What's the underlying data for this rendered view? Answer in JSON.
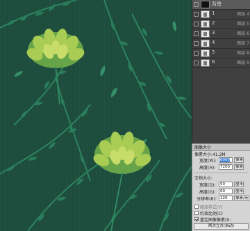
{
  "layers_panel": {
    "layers": [
      {
        "name": "背景",
        "suffix": "",
        "thumb": "dark",
        "selected": true
      },
      {
        "name": "1",
        "suffix": "图层 4",
        "thumb": "light",
        "selected": false
      },
      {
        "name": "2",
        "suffix": "图层 5",
        "thumb": "light",
        "selected": false
      },
      {
        "name": "3",
        "suffix": "图层 6",
        "thumb": "light",
        "selected": false
      },
      {
        "name": "4",
        "suffix": "图层 7",
        "thumb": "light",
        "selected": false
      },
      {
        "name": "5",
        "suffix": "图层 8",
        "thumb": "light",
        "selected": false
      },
      {
        "name": "6",
        "suffix": "图层 9",
        "thumb": "light",
        "selected": false
      }
    ]
  },
  "image_size_dialog": {
    "title": "图像大小",
    "pixel_section": {
      "label": "像素大小:41.2M",
      "width_label": "宽度(W):",
      "width_value": "6000",
      "width_unit": "像素",
      "height_label": "高度(H):",
      "height_value": "7200",
      "height_unit": "像素"
    },
    "doc_section": {
      "label": "文档大小:",
      "width_label": "宽度(D):",
      "width_value": "50",
      "width_unit": "厘米",
      "height_label": "高度(G):",
      "height_value": "60",
      "height_unit": "厘米",
      "res_label": "分辨率(R):",
      "res_value": "120",
      "res_unit": "像素/英寸"
    },
    "options": {
      "scale_styles": "缩放样式(Y)",
      "constrain": "约束比例(C)",
      "resample": "重定图像像素(I):"
    },
    "resample_method": "两次立方(自动)"
  },
  "colors": {
    "canvas_bg": "#1e4c3d",
    "leaf_dark": "#1f6a4f",
    "leaf_mid": "#2e8d66",
    "flower_yellow": "#9ec24a",
    "panel_bg": "#3f3f3f",
    "dialog_bg": "#d4d4d4"
  }
}
